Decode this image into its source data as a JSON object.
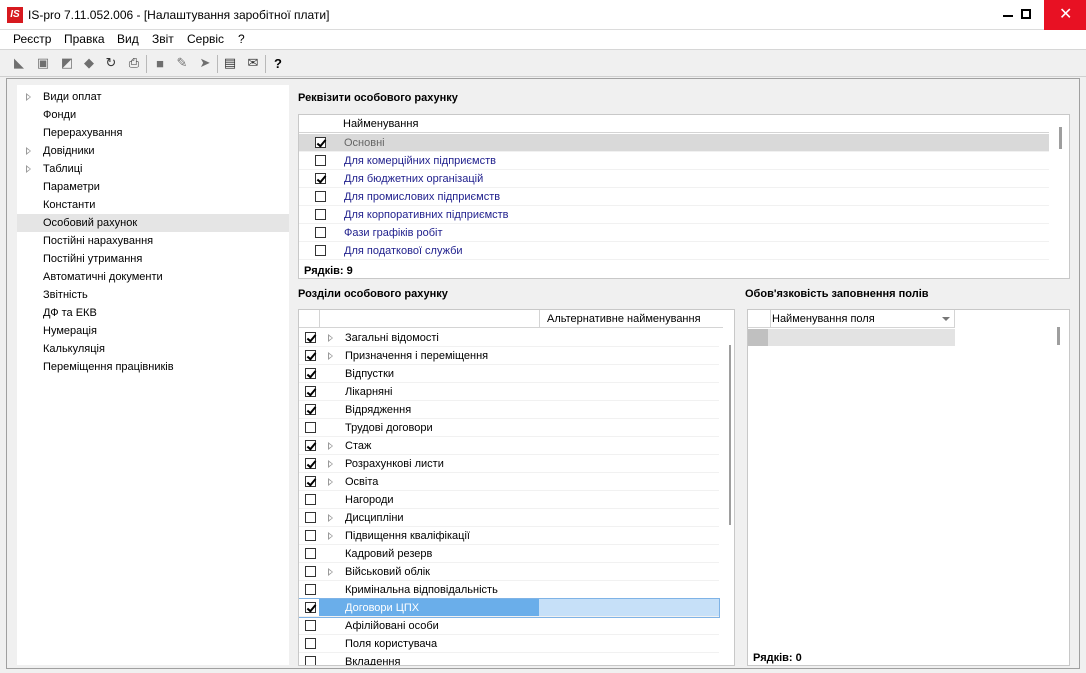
{
  "window": {
    "title": "IS-pro 7.11.052.006 - [Налаштування заробітної плати]",
    "app_icon_text": "IS",
    "close_color": "#e81123"
  },
  "menu": [
    "Реєстр",
    "Правка",
    "Вид",
    "Звіт",
    "Сервіс",
    "?"
  ],
  "toolbar_icons": [
    "new-icon",
    "new-doc-icon",
    "copy-icon",
    "delete-icon",
    "refresh-icon",
    "print-icon",
    "square-icon",
    "tool-icon",
    "tool2-icon",
    "calculator-icon",
    "mail-icon",
    "help-icon"
  ],
  "nav": {
    "items": [
      {
        "label": "Види оплат",
        "expandable": true
      },
      {
        "label": "Фонди",
        "expandable": false
      },
      {
        "label": "Перерахування",
        "expandable": false
      },
      {
        "label": "Довідники",
        "expandable": true
      },
      {
        "label": "Таблиці",
        "expandable": true
      },
      {
        "label": "Параметри",
        "expandable": false
      },
      {
        "label": "Константи",
        "expandable": false
      },
      {
        "label": "Особовий рахунок",
        "expandable": false,
        "selected": true
      },
      {
        "label": "Постійні нарахування",
        "expandable": false
      },
      {
        "label": "Постійні утримання",
        "expandable": false
      },
      {
        "label": "Автоматичні документи",
        "expandable": false
      },
      {
        "label": "Звітність",
        "expandable": false
      },
      {
        "label": "ДФ та ЕКВ",
        "expandable": false
      },
      {
        "label": "Нумерація",
        "expandable": false
      },
      {
        "label": "Калькуляція",
        "expandable": false
      },
      {
        "label": "Переміщення працівників",
        "expandable": false
      }
    ]
  },
  "requisites": {
    "title": "Реквізити особового рахунку",
    "column": "Найменування",
    "rows": [
      {
        "label": "Основні",
        "checked": true,
        "selected": true
      },
      {
        "label": "Для комерційних підприємств",
        "checked": false
      },
      {
        "label": "Для бюджетних організацій",
        "checked": true
      },
      {
        "label": "Для промислових підприємств",
        "checked": false
      },
      {
        "label": "Для корпоративних підприємств",
        "checked": false
      },
      {
        "label": "Фази графіків робіт",
        "checked": false
      },
      {
        "label": "Для податкової служби",
        "checked": false
      }
    ],
    "footer": "Рядків: 9"
  },
  "sections": {
    "title": "Розділи особового рахунку",
    "column_alt": "Альтернативне найменування",
    "rows": [
      {
        "label": "Загальні відомості",
        "checked": true,
        "expand": true
      },
      {
        "label": "Призначення і переміщення",
        "checked": true,
        "expand": true
      },
      {
        "label": "Відпустки",
        "checked": true,
        "expand": false
      },
      {
        "label": "Лікарняні",
        "checked": true,
        "expand": false
      },
      {
        "label": "Відрядження",
        "checked": true,
        "expand": false
      },
      {
        "label": "Трудові договори",
        "checked": false,
        "expand": false
      },
      {
        "label": "Стаж",
        "checked": true,
        "expand": true
      },
      {
        "label": "Розрахункові листи",
        "checked": true,
        "expand": true
      },
      {
        "label": "Освіта",
        "checked": true,
        "expand": true
      },
      {
        "label": "Нагороди",
        "checked": false,
        "expand": false
      },
      {
        "label": "Дисципліни",
        "checked": false,
        "expand": true
      },
      {
        "label": "Підвищення кваліфікації",
        "checked": false,
        "expand": true
      },
      {
        "label": "Кадровий резерв",
        "checked": false,
        "expand": false
      },
      {
        "label": "Військовий облік",
        "checked": false,
        "expand": true
      },
      {
        "label": "Кримінальна відповідальність",
        "checked": false,
        "expand": false
      },
      {
        "label": "Договори ЦПХ",
        "checked": true,
        "expand": false,
        "selected": true
      },
      {
        "label": "Афілійовані особи",
        "checked": false,
        "expand": false
      },
      {
        "label": "Поля користувача",
        "checked": false,
        "expand": false
      },
      {
        "label": "Вкладення",
        "checked": false,
        "expand": false
      }
    ],
    "selected_color": "#6aaeea"
  },
  "required": {
    "title": "Обов'язковість заповнення полів",
    "column": "Найменування поля",
    "footer": "Рядків: 0"
  }
}
